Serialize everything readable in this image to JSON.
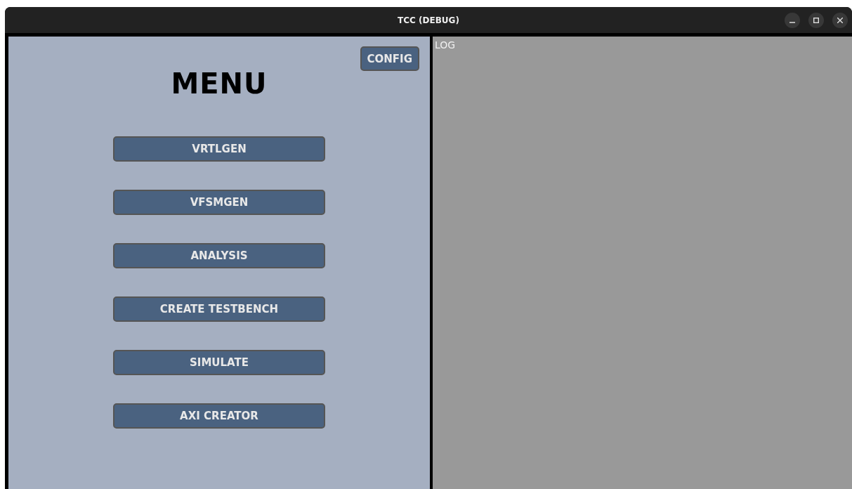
{
  "window": {
    "title": "TCC (DEBUG)"
  },
  "menu": {
    "config_button": "CONFIG",
    "title": "MENU",
    "buttons": [
      "VRTLGEN",
      "VFSMGEN",
      "ANALYSIS",
      "CREATE TESTBENCH",
      "SIMULATE",
      "AXI CREATOR"
    ]
  },
  "log": {
    "title": "LOG"
  }
}
